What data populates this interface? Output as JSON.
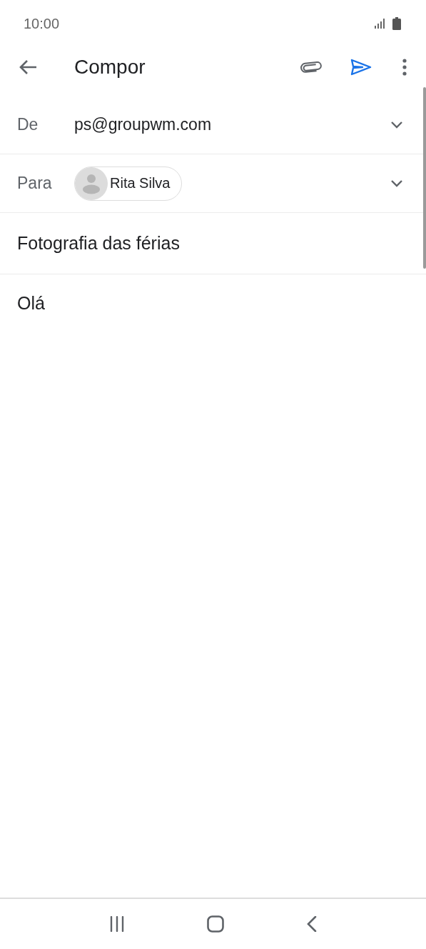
{
  "status_bar": {
    "time": "10:00"
  },
  "toolbar": {
    "title": "Compor"
  },
  "from": {
    "label": "De",
    "value": "ps@groupwm.com"
  },
  "to": {
    "label": "Para",
    "recipients": [
      {
        "name": "Rita Silva"
      }
    ]
  },
  "subject": {
    "value": "Fotografia das férias"
  },
  "body": {
    "value": "Olá"
  }
}
